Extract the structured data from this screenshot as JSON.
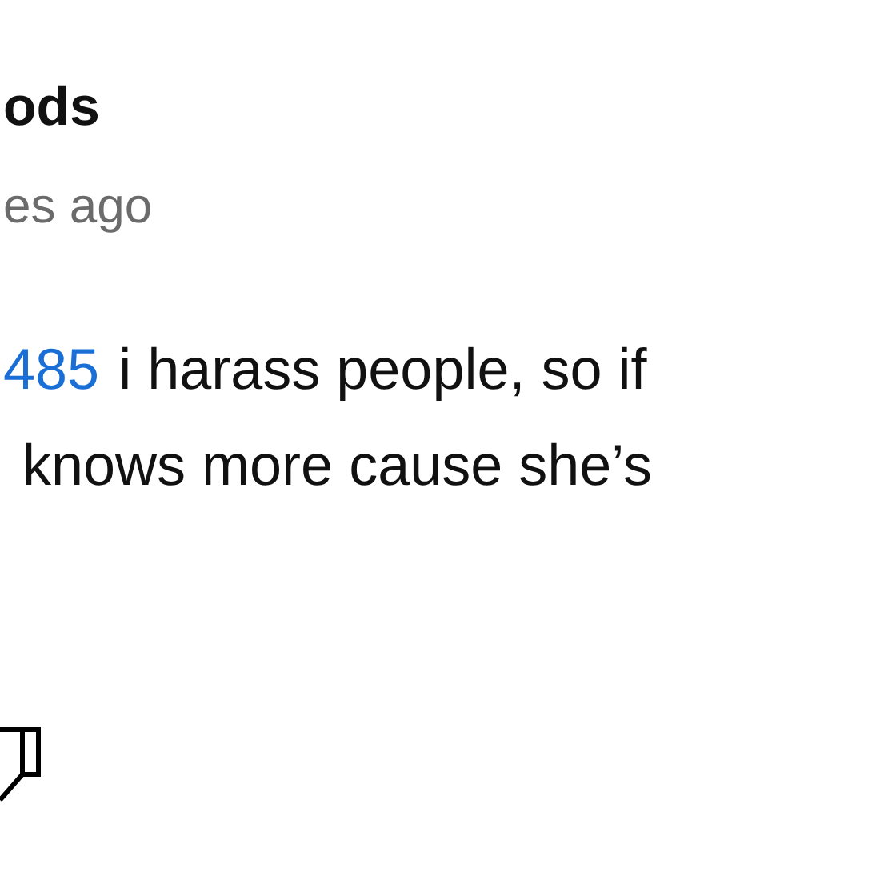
{
  "comment": {
    "author": "ods",
    "time": "es ago",
    "mention": "485",
    "body_line_1": "i harass people, so if",
    "body_line_2": "knows more cause she’s"
  }
}
